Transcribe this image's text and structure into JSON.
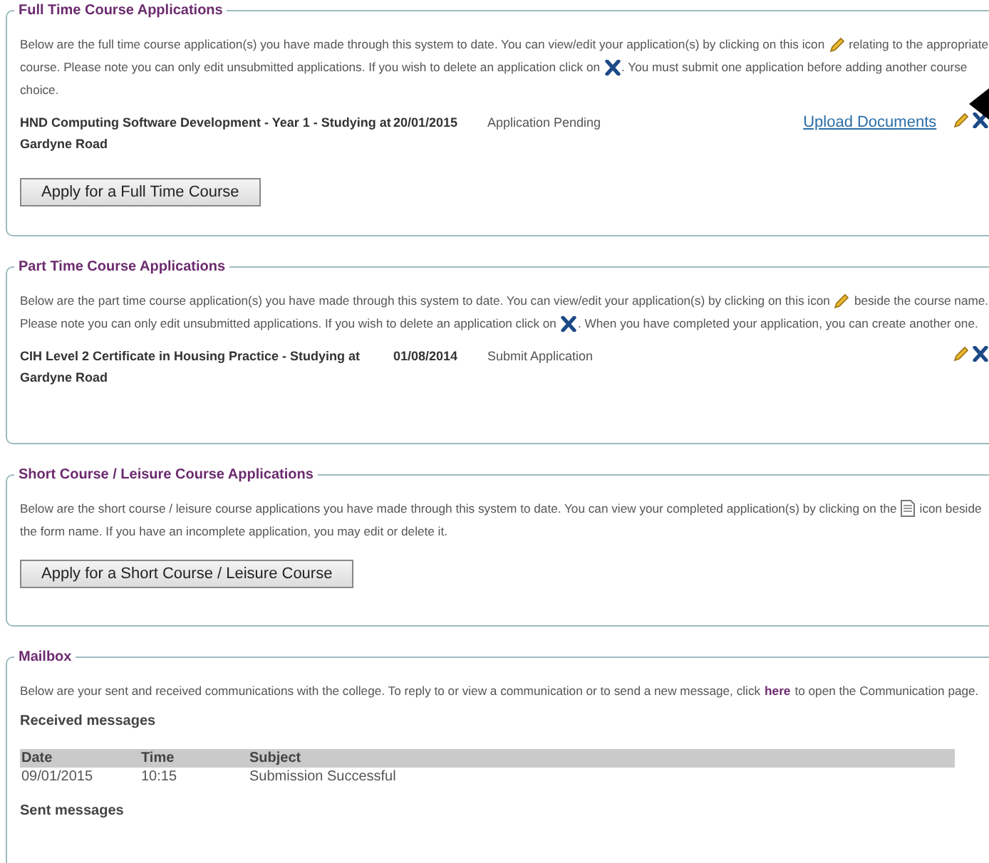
{
  "sections": [
    {
      "kind": "applications",
      "legend": "Full Time Course Applications",
      "intro": [
        [
          {
            "kind": "text",
            "text": "Below are the full time course application(s) you have made through this system to date. You can view/edit your application(s) by clicking on this icon"
          },
          {
            "kind": "pencil"
          },
          {
            "kind": "text",
            "text": "relating to the appropriate"
          }
        ],
        [
          {
            "kind": "text",
            "text": "course. Please note you can only edit unsubmitted applications. If you wish to delete an application click on"
          },
          {
            "kind": "cross"
          },
          {
            "kind": "text",
            "text": ". You must submit one application before adding another course"
          }
        ],
        [
          {
            "kind": "text",
            "text": "choice."
          }
        ]
      ],
      "rows": [
        {
          "course": "HND Computing Software Development - Year 1 - Studying at Gardyne Road",
          "date": "20/01/2015",
          "status": "Application Pending",
          "link": "Upload Documents"
        }
      ],
      "button": "Apply for a Full Time Course"
    },
    {
      "kind": "applications",
      "legend": "Part Time Course Applications",
      "intro": [
        [
          {
            "kind": "text",
            "text": "Below are the part time course application(s) you have made through this system to date. You can view/edit your application(s) by clicking on this icon"
          },
          {
            "kind": "pencil"
          },
          {
            "kind": "text",
            "text": "beside the course name."
          }
        ],
        [
          {
            "kind": "text",
            "text": "Please note you can only edit unsubmitted applications. If you wish to delete an application click on"
          },
          {
            "kind": "cross"
          },
          {
            "kind": "text",
            "text": ". When you have completed your application, you can create another one."
          }
        ]
      ],
      "rows": [
        {
          "course": "CIH Level 2 Certificate in Housing Practice - Studying at Gardyne Road",
          "date": "01/08/2014",
          "status": "Submit Application"
        }
      ]
    },
    {
      "kind": "applications",
      "legend": "Short Course / Leisure Course Applications",
      "intro": [
        [
          {
            "kind": "text",
            "text": "Below are the short course / leisure course applications you have made through this system to date. You can view your completed application(s) by clicking on the"
          },
          {
            "kind": "document"
          },
          {
            "kind": "text",
            "text": "icon beside"
          }
        ],
        [
          {
            "kind": "text",
            "text": "the form name. If you have an incomplete application, you may edit or delete it."
          }
        ]
      ],
      "button": "Apply for a Short Course / Leisure Course"
    },
    {
      "kind": "mailbox",
      "legend": "Mailbox",
      "intro": [
        [
          {
            "kind": "text",
            "text": "Below are your sent and received communications with the college. To reply to or view a communication or to send a new message, click"
          },
          {
            "kind": "link",
            "text": "here"
          },
          {
            "kind": "text",
            "text": "to open the Communication page."
          }
        ]
      ],
      "received_heading": "Received messages",
      "columns": [
        "Date",
        "Time",
        "Subject"
      ],
      "messages": [
        [
          "09/01/2015",
          "10:15",
          "Submission Successful"
        ]
      ],
      "sent_heading": "Sent messages"
    }
  ]
}
